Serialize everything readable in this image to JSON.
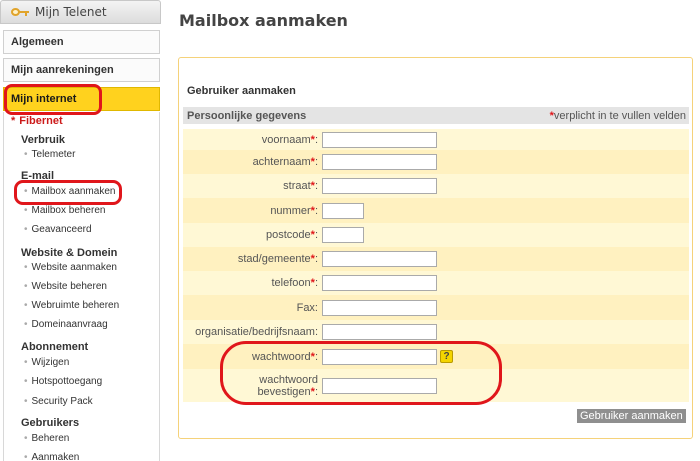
{
  "sidebar": {
    "top_tab": "Mijn Telenet",
    "menu": [
      "Algemeen",
      "Mijn aanrekeningen",
      "Mijn internet"
    ],
    "active_section": "Fibernet",
    "groups": [
      {
        "title": "Verbruik",
        "items": [
          "Telemeter"
        ]
      },
      {
        "title": "E-mail",
        "items": [
          "Mailbox aanmaken",
          "Mailbox beheren",
          "Geavanceerd"
        ]
      },
      {
        "title": "Website & Domein",
        "items": [
          "Website aanmaken",
          "Website beheren",
          "Webruimte beheren",
          "Domeinaanvraag"
        ]
      },
      {
        "title": "Abonnement",
        "items": [
          "Wijzigen",
          "Hotspottoegang",
          "Security Pack"
        ]
      },
      {
        "title": "Gebruikers",
        "items": [
          "Beheren",
          "Aanmaken"
        ]
      }
    ]
  },
  "main": {
    "page_title": "Mailbox aanmaken",
    "form_title": "Gebruiker aanmaken",
    "section_label": "Persoonlijke gegevens",
    "required_note": "verplicht in te vullen velden",
    "required_star": "*",
    "fields": {
      "voornaam": {
        "label": "voornaam",
        "value": ""
      },
      "achternaam": {
        "label": "achternaam",
        "value": ""
      },
      "straat": {
        "label": "straat",
        "value": ""
      },
      "nummer": {
        "label": "nummer",
        "value": ""
      },
      "postcode": {
        "label": "postcode",
        "value": ""
      },
      "stad": {
        "label": "stad/gemeente",
        "value": ""
      },
      "telefoon": {
        "label": "telefoon",
        "value": ""
      },
      "fax": {
        "label": "Fax:",
        "value": ""
      },
      "organisatie": {
        "label": "organisatie/bedrijfsnaam:",
        "value": ""
      },
      "wachtwoord": {
        "label": "wachtwoord",
        "value": ""
      },
      "wachtwoord_bevestigen": {
        "label_line1": "wachtwoord",
        "label_line2": "bevestigen",
        "value": ""
      }
    },
    "help_glyph": "?",
    "submit_label": "Gebruiker aanmaken"
  },
  "colors": {
    "accent_yellow": "#ffd21e",
    "row_odd": "#fff8d5",
    "row_even": "#fff1c0",
    "required": "#e0161b",
    "annotation": "#e0161b"
  }
}
